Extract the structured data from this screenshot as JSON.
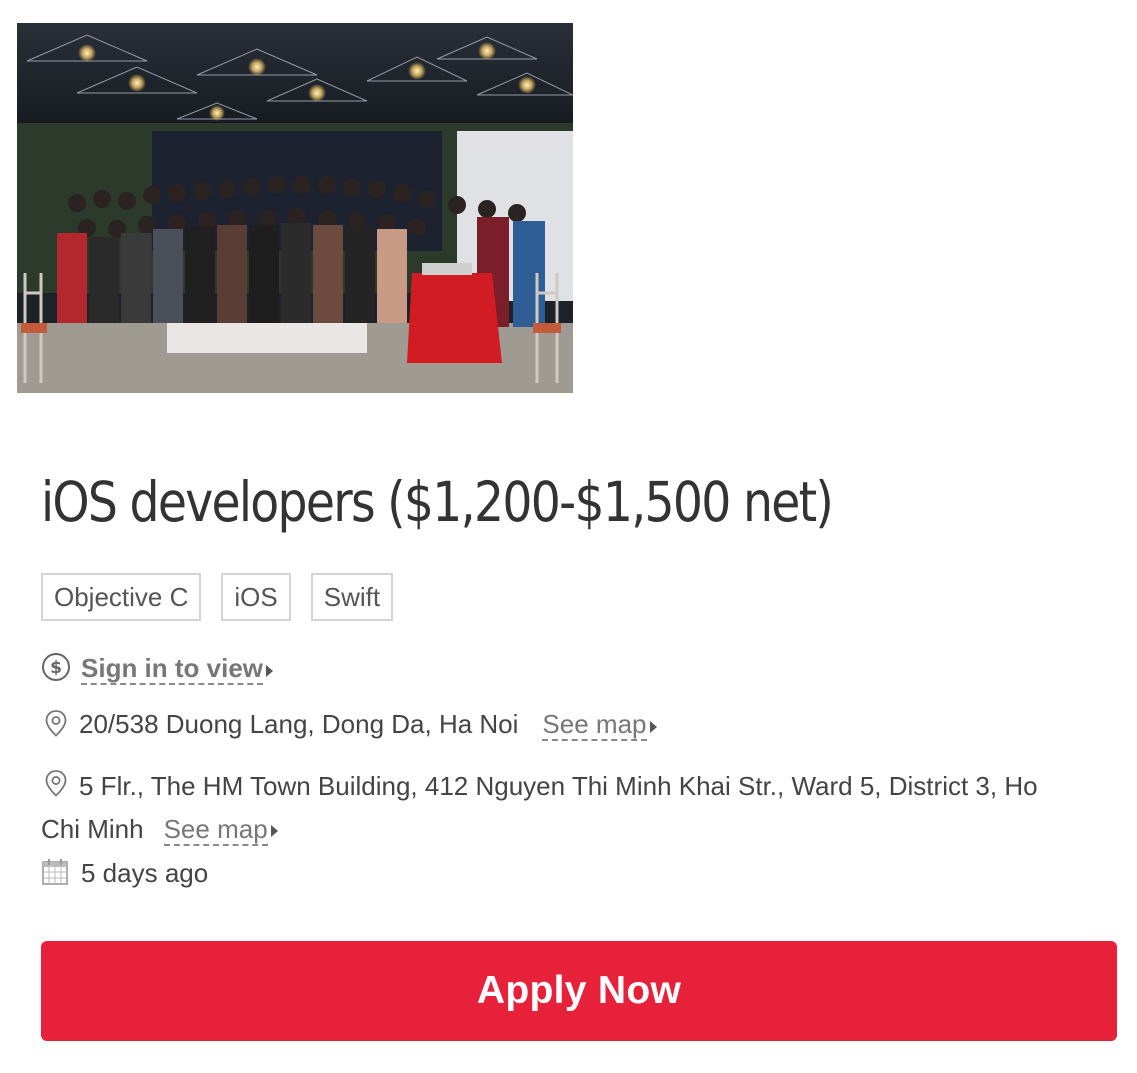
{
  "job": {
    "title": "iOS developers ($1,200-$1,500 net)",
    "tags": [
      "Objective C",
      "iOS",
      "Swift"
    ]
  },
  "salary": {
    "icon": "dollar-circle-icon",
    "link_label": "Sign in to view"
  },
  "locations": [
    {
      "icon": "map-pin-icon",
      "address": "20/538 Duong Lang, Dong Da, Ha Noi",
      "map_link": "See map"
    },
    {
      "icon": "map-pin-icon",
      "address": "5 Flr., The HM Town Building, 412 Nguyen Thi Minh Khai Str., Ward 5, District 3, Ho Chi Minh",
      "map_link": "See map"
    }
  ],
  "posted": {
    "icon": "calendar-icon",
    "text": "5 days ago"
  },
  "apply_button": {
    "label": "Apply Now"
  },
  "colors": {
    "brand_red": "#e8213a",
    "text": "#444444",
    "muted": "#777777",
    "tag_border": "#d4d4d4"
  }
}
